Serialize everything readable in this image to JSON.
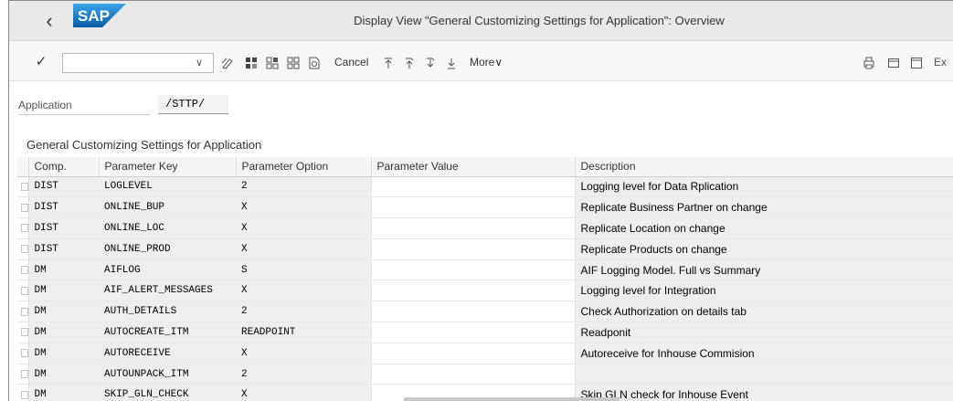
{
  "window": {
    "title": "Display View \"General Customizing Settings for Application\": Overview",
    "logo_text": "SAP"
  },
  "toolbar": {
    "cancel_label": "Cancel",
    "more_label": "More",
    "exit_label": "Ex",
    "command_value": ""
  },
  "application": {
    "label": "Application",
    "value": "/STTP/"
  },
  "section": {
    "title": "General Customizing Settings for Application"
  },
  "table": {
    "columns": [
      "Comp.",
      "Parameter Key",
      "Parameter Option",
      "Parameter Value",
      "Description"
    ],
    "rows": [
      {
        "comp": "DIST",
        "key": "LOGLEVEL",
        "option": "2",
        "value": "",
        "desc": "Logging level for Data Rplication"
      },
      {
        "comp": "DIST",
        "key": "ONLINE_BUP",
        "option": "X",
        "value": "",
        "desc": "Replicate Business Partner on change"
      },
      {
        "comp": "DIST",
        "key": "ONLINE_LOC",
        "option": "X",
        "value": "",
        "desc": "Replicate Location on change"
      },
      {
        "comp": "DIST",
        "key": "ONLINE_PROD",
        "option": "X",
        "value": "",
        "desc": "Replicate Products on change"
      },
      {
        "comp": "DM",
        "key": "AIFLOG",
        "option": "S",
        "value": "",
        "desc": "AIF Logging Model. Full vs Summary"
      },
      {
        "comp": "DM",
        "key": "AIF_ALERT_MESSAGES",
        "option": "X",
        "value": "",
        "desc": "Logging level for Integration"
      },
      {
        "comp": "DM",
        "key": "AUTH_DETAILS",
        "option": "2",
        "value": "",
        "desc": "Check Authorization on details tab"
      },
      {
        "comp": "DM",
        "key": "AUTOCREATE_ITM",
        "option": "READPOINT",
        "value": "",
        "desc": "Readponit"
      },
      {
        "comp": "DM",
        "key": "AUTORECEIVE",
        "option": "X",
        "value": "",
        "desc": "Autoreceive for Inhouse Commision"
      },
      {
        "comp": "DM",
        "key": "AUTOUNPACK_ITM",
        "option": "2",
        "value": "",
        "desc": ""
      },
      {
        "comp": "DM",
        "key": "SKIP_GLN_CHECK",
        "option": "X",
        "value": "",
        "desc": "Skip GLN check for Inhouse Event"
      }
    ]
  },
  "colors": {
    "titlebar_bg": "#e9e9e9",
    "toolbar_bg": "#f7f7f7",
    "logo_blue": "#1a79c8",
    "readonly_cell_bg": "#eeeeee"
  }
}
